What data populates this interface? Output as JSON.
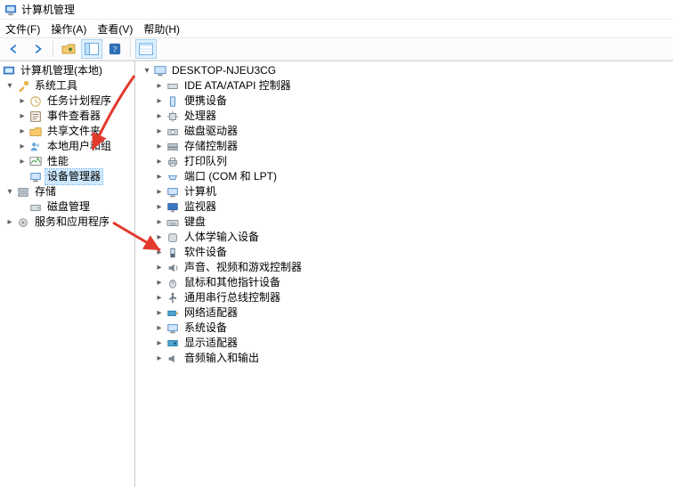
{
  "window": {
    "title": "计算机管理"
  },
  "menu": {
    "file": "文件(F)",
    "action": "操作(A)",
    "view": "查看(V)",
    "help": "帮助(H)"
  },
  "toolbar_icons": {
    "back": "back-icon",
    "forward": "forward-icon",
    "up": "up-icon",
    "show_hide": "show-hide-icon",
    "help": "help-icon",
    "details": "details-icon"
  },
  "left_tree": {
    "root": "计算机管理(本地)",
    "system_tools": {
      "label": "系统工具",
      "children": {
        "task_scheduler": "任务计划程序",
        "event_viewer": "事件查看器",
        "shared_folders": "共享文件夹",
        "local_users": "本地用户和组",
        "performance": "性能",
        "device_manager": "设备管理器"
      }
    },
    "storage": {
      "label": "存储",
      "children": {
        "disk_mgmt": "磁盘管理"
      }
    },
    "services_apps": "服务和应用程序"
  },
  "right_tree": {
    "computer_name": "DESKTOP-NJEU3CG",
    "categories": {
      "ide": "IDE ATA/ATAPI 控制器",
      "portable": "便携设备",
      "cpu": "处理器",
      "disk_drives": "磁盘驱动器",
      "storage_ctrl": "存储控制器",
      "print_queues": "打印队列",
      "ports": "端口 (COM 和 LPT)",
      "computer": "计算机",
      "monitors": "监视器",
      "keyboards": "键盘",
      "hid": "人体学输入设备",
      "software_dev": "软件设备",
      "sound": "声音、视频和游戏控制器",
      "mice": "鼠标和其他指针设备",
      "usb": "通用串行总线控制器",
      "network": "网络适配器",
      "system_dev": "系统设备",
      "display": "显示适配器",
      "audio_io": "音频输入和输出"
    }
  },
  "arrows": {
    "color": "#e23b2e"
  }
}
